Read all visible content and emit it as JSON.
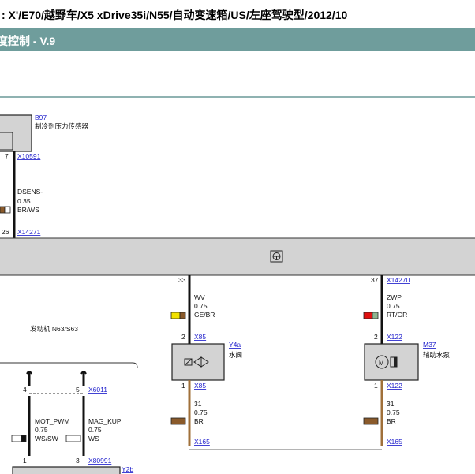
{
  "header": {
    "vehicle_path": ": X'/E70/越野车/X5 xDrive35i/N55/自动变速箱/US/左座驾驶型/2012/10",
    "diagram_title": "度控制 - V.9"
  },
  "components": {
    "b97": {
      "id": "B97",
      "name": "制冷剂压力传感器"
    },
    "y4a": {
      "id": "Y4a",
      "name": "水阀"
    },
    "m37": {
      "id": "M37",
      "name": "辅助水泵"
    },
    "y2b": {
      "id": "Y2b"
    },
    "engine_block": {
      "name": "发动机 N63/S63"
    }
  },
  "connectors": {
    "x10591": {
      "id": "X10591",
      "pin": "7"
    },
    "x14271": {
      "id": "X14271",
      "pin": "26"
    },
    "x14270_left": {
      "pin": "33"
    },
    "x14270_right": {
      "id": "X14270",
      "pin": "37"
    },
    "x85_top": {
      "id": "X85",
      "pin": "2"
    },
    "x85_bot": {
      "id": "X85",
      "pin": "1"
    },
    "x122_top": {
      "id": "X122",
      "pin": "2"
    },
    "x122_bot": {
      "id": "X122",
      "pin": "1"
    },
    "x165_left": {
      "id": "X165"
    },
    "x165_right": {
      "id": "X165"
    },
    "x6011": {
      "id": "X6011",
      "pin_left": "4",
      "pin_right": "5"
    },
    "x80991": {
      "id": "X80991",
      "pin_left": "1",
      "pin_right": "3"
    }
  },
  "wires": {
    "dsens": {
      "signal": "DSENS-",
      "gauge": "0.35",
      "color": "BR/WS"
    },
    "wv": {
      "signal": "WV",
      "gauge": "0.75",
      "color": "GE/BR"
    },
    "zwp": {
      "signal": "ZWP",
      "gauge": "0.75",
      "color": "RT/GR"
    },
    "gnd_left": {
      "signal": "31",
      "gauge": "0.75",
      "color": "BR"
    },
    "gnd_right": {
      "signal": "31",
      "gauge": "0.75",
      "color": "BR"
    },
    "mot_pwm": {
      "signal": "MOT_PWM",
      "gauge": "0.75",
      "color": "WS/SW"
    },
    "mag_kup": {
      "signal": "MAG_KUP",
      "gauge": "0.75",
      "color": "WS"
    }
  },
  "colors": {
    "title_bar": "#6f9d9c",
    "module_bar": "#d3d3d3",
    "wire_black": "#111111",
    "wire_brown": "#a0703a",
    "swatch_yellow": "#f2e200",
    "swatch_red": "#e01010",
    "swatch_brown": "#8a5a2b"
  }
}
